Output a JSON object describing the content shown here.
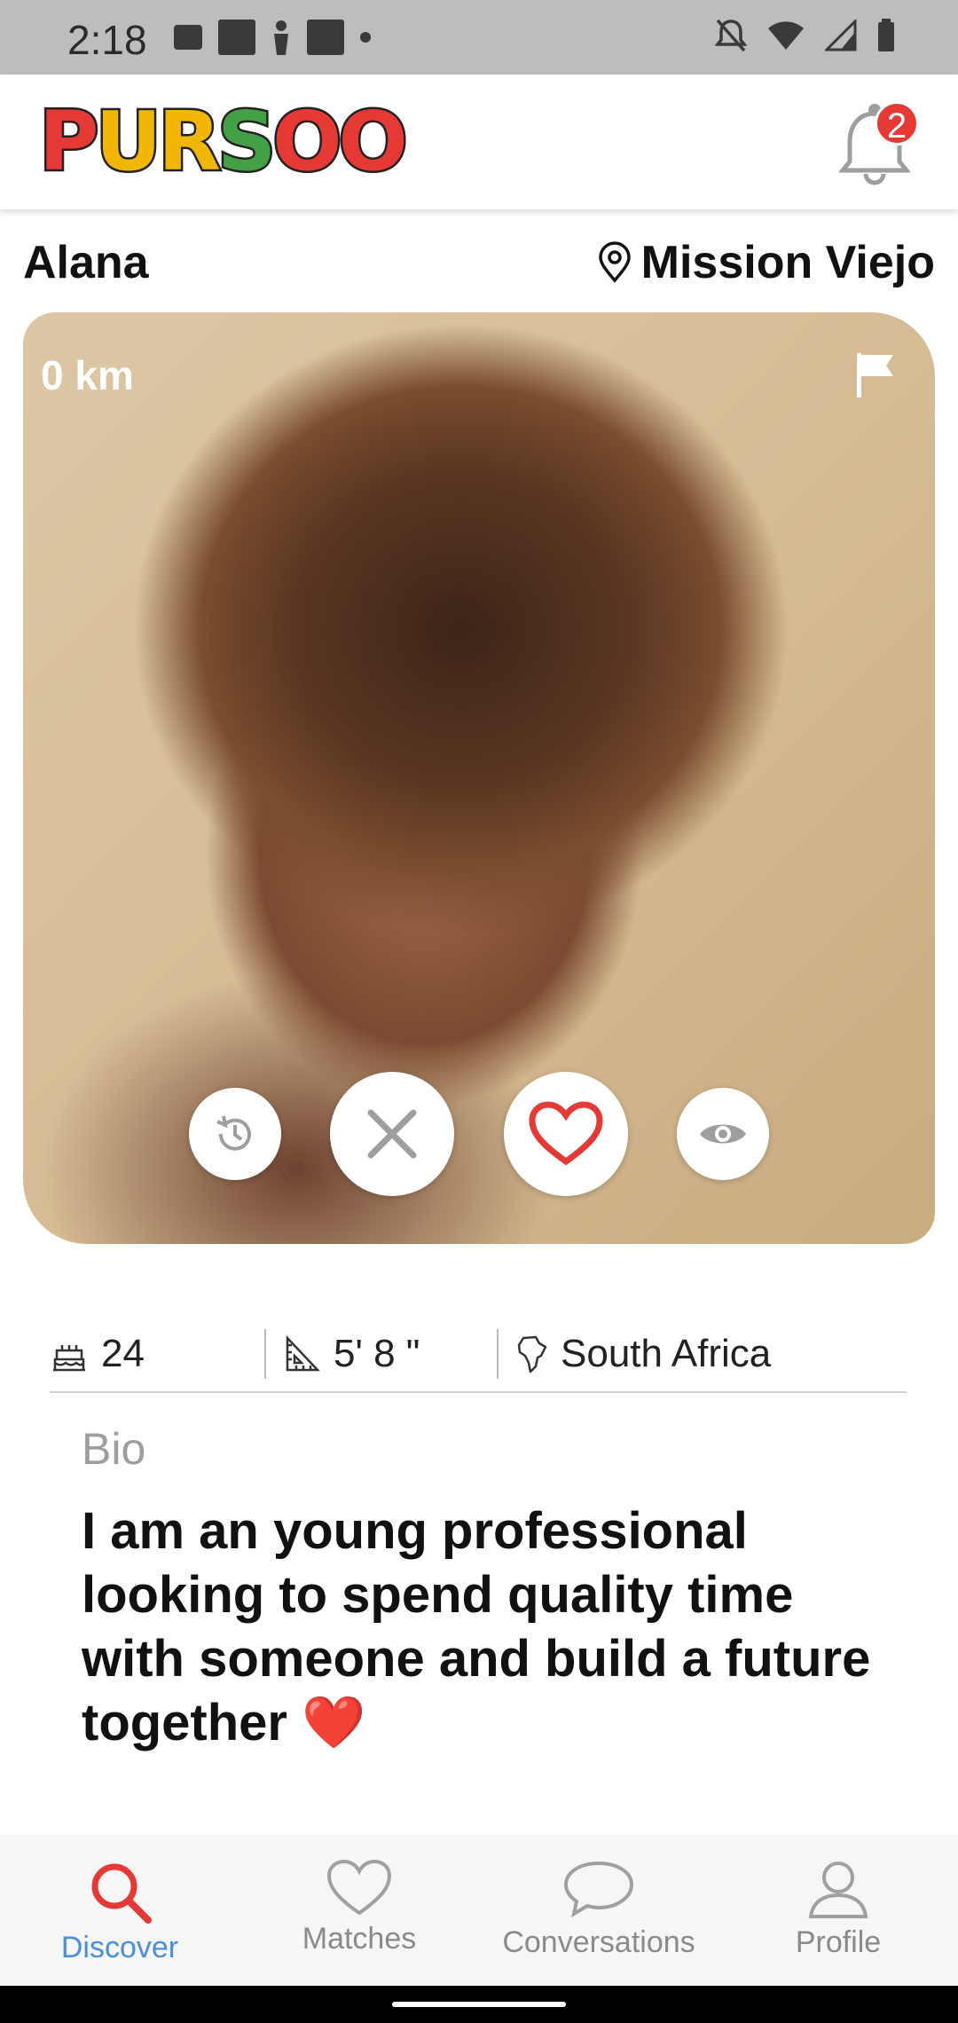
{
  "status_bar": {
    "time": "2:18"
  },
  "header": {
    "logo_text": [
      "P",
      "U",
      "R",
      "S",
      "O",
      "O"
    ],
    "logo_colors": [
      "#e53935",
      "#f2b705",
      "#f2b705",
      "#43a047",
      "#e53935",
      "#e53935"
    ],
    "notification_count": "2"
  },
  "profile": {
    "name": "Alana",
    "location": "Mission Viejo",
    "distance": "0 km"
  },
  "stats": {
    "age": "24",
    "height": "5' 8 \"",
    "country": "South Africa"
  },
  "bio": {
    "label": "Bio",
    "text": "I am an young professional looking to spend quality time with someone and build a future together ❤️"
  },
  "nav": {
    "items": [
      {
        "label": "Discover"
      },
      {
        "label": "Matches"
      },
      {
        "label": "Conversations"
      },
      {
        "label": "Profile"
      }
    ]
  },
  "colors": {
    "accent_red": "#e53935",
    "active_blue": "#4a90d9"
  }
}
